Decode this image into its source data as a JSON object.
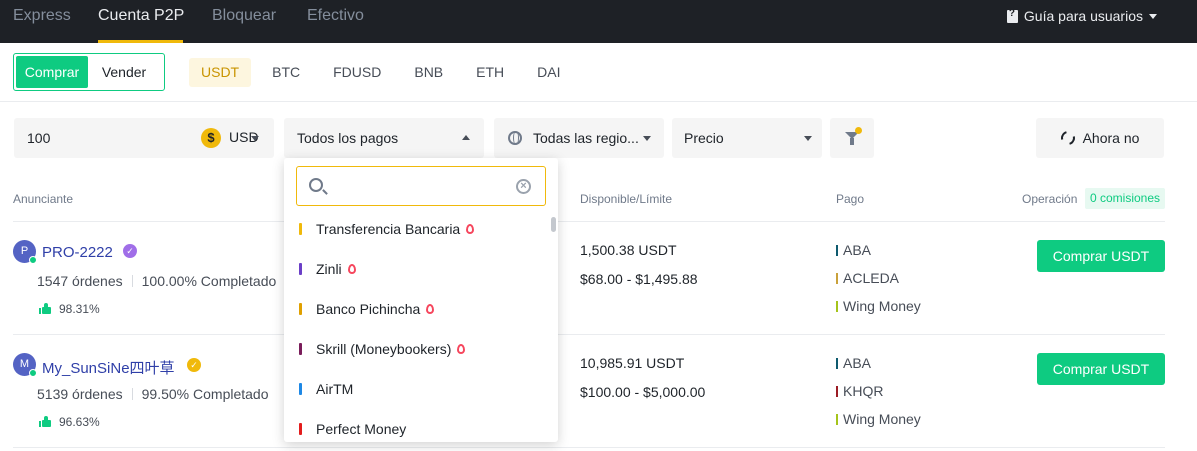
{
  "nav": {
    "tabs": [
      {
        "label": "Express"
      },
      {
        "label": "Cuenta P2P",
        "active": true
      },
      {
        "label": "Bloquear"
      },
      {
        "label": "Efectivo"
      }
    ],
    "guide_label": "Guía para usuarios"
  },
  "trade_toggle": {
    "buy": "Comprar",
    "sell": "Vender",
    "selected": "Comprar"
  },
  "assets": [
    "USDT",
    "BTC",
    "FDUSD",
    "BNB",
    "ETH",
    "DAI"
  ],
  "selected_asset": "USDT",
  "filters": {
    "amount": "100",
    "currency_symbol": "$",
    "currency": "USD",
    "payments": "Todos los pagos",
    "regions": "Todas las regio...",
    "sort": "Precio",
    "refresh_label": "Ahora no"
  },
  "table_headers": {
    "advertiser": "Anunciante",
    "available": "Disponible/Límite",
    "payment": "Pago",
    "operation": "Operación",
    "fees_badge": "0 comisiones"
  },
  "rows": [
    {
      "avatar": "P",
      "name": "PRO-2222",
      "orders": "1547 órdenes",
      "completion": "100.00% Completado",
      "rating": "98.31%",
      "available": "1,500.38 USDT",
      "limit": "$68.00 - $1,495.88",
      "payments": [
        "ABA",
        "ACLEDA",
        "Wing Money"
      ],
      "button": "Comprar USDT"
    },
    {
      "avatar": "M",
      "name": "My_SunSiNe四叶草",
      "orders": "5139 órdenes",
      "completion": "99.50% Completado",
      "rating": "96.63%",
      "available": "10,985.91 USDT",
      "limit": "$100.00 - $5,000.00",
      "payments": [
        "ABA",
        "KHQR",
        "Wing Money"
      ],
      "button": "Comprar USDT"
    }
  ],
  "payment_colors": {
    "ABA": "#0e5a6e",
    "ACLEDA": "#c9a13b",
    "Wing Money": "#a5c41b",
    "KHQR": "#9b1c24"
  },
  "dropdown": {
    "search_placeholder": "",
    "items": [
      {
        "label": "Transferencia Bancaria",
        "color": "#f0b90b",
        "hot": true
      },
      {
        "label": "Zinli",
        "color": "#6b3fc7",
        "hot": true
      },
      {
        "label": "Banco Pichincha",
        "color": "#e0a000",
        "hot": true
      },
      {
        "label": "Skrill (Moneybookers)",
        "color": "#7a1d5a",
        "hot": true
      },
      {
        "label": "AirTM",
        "color": "#1e88e5",
        "hot": false
      },
      {
        "label": "Perfect Money",
        "color": "#e31d1d",
        "hot": false
      }
    ]
  },
  "colors": {
    "accent": "#f0b90b",
    "buy_green": "#0ecb81",
    "nav_bg": "#1e2126"
  }
}
